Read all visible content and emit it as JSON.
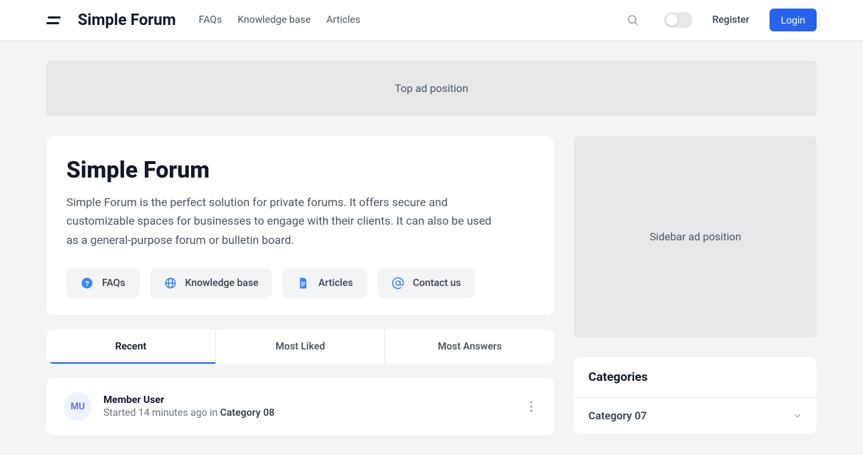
{
  "header": {
    "brand": "Simple Forum",
    "nav": [
      "FAQs",
      "Knowledge base",
      "Articles"
    ],
    "register": "Register",
    "login": "Login"
  },
  "ads": {
    "top": "Top ad position",
    "sidebar": "Sidebar ad position"
  },
  "hero": {
    "title": "Simple Forum",
    "description": "Simple Forum is the perfect solution for private forums. It offers secure and customizable spaces for businesses to engage with their clients. It can also be used as a general-purpose forum or bulletin board.",
    "buttons": [
      "FAQs",
      "Knowledge base",
      "Articles",
      "Contact us"
    ]
  },
  "tabs": [
    "Recent",
    "Most Liked",
    "Most Answers"
  ],
  "post": {
    "avatar": "MU",
    "username": "Member User",
    "started_prefix": "Started ",
    "time": "14 minutes ago",
    "in": " in ",
    "category": "Category 08"
  },
  "categories": {
    "title": "Categories",
    "items": [
      "Category 07"
    ]
  }
}
